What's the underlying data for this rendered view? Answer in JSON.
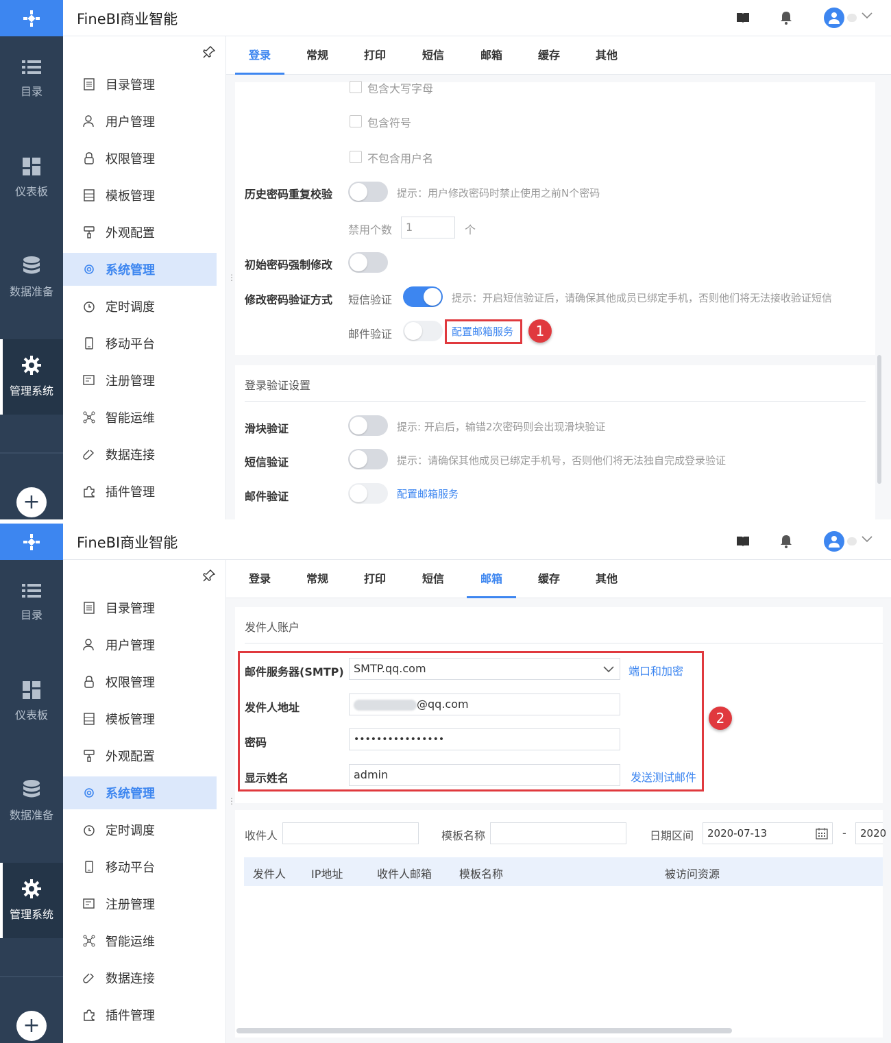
{
  "app": {
    "title": "FineBI商业智能"
  },
  "rail": {
    "items": [
      {
        "label": "目录",
        "icon": "list-icon"
      },
      {
        "label": "仪表板",
        "icon": "dashboard-icon"
      },
      {
        "label": "数据准备",
        "icon": "database-icon"
      },
      {
        "label": "管理系统",
        "icon": "gear-icon"
      }
    ],
    "add": "+"
  },
  "menu": {
    "items": [
      {
        "label": "目录管理",
        "icon": "catalog-icon"
      },
      {
        "label": "用户管理",
        "icon": "user-icon"
      },
      {
        "label": "权限管理",
        "icon": "lock-icon"
      },
      {
        "label": "模板管理",
        "icon": "template-icon"
      },
      {
        "label": "外观配置",
        "icon": "brush-icon"
      },
      {
        "label": "系统管理",
        "icon": "settings-icon"
      },
      {
        "label": "定时调度",
        "icon": "clock-icon"
      },
      {
        "label": "移动平台",
        "icon": "mobile-icon"
      },
      {
        "label": "注册管理",
        "icon": "register-icon"
      },
      {
        "label": "智能运维",
        "icon": "network-icon"
      },
      {
        "label": "数据连接",
        "icon": "link-icon"
      },
      {
        "label": "插件管理",
        "icon": "puzzle-icon"
      }
    ],
    "active_index": 5
  },
  "tabs": [
    "登录",
    "常规",
    "打印",
    "短信",
    "邮箱",
    "缓存",
    "其他"
  ],
  "panel1": {
    "active_tab": 0,
    "checkboxes": [
      "包含大写字母",
      "包含符号",
      "不包含用户名"
    ],
    "history_check": {
      "label": "历史密码重复校验",
      "hint": "提示：用户修改密码时禁止使用之前N个密码",
      "on": false
    },
    "forbid_count": {
      "label": "禁用个数",
      "value": "1",
      "unit": "个"
    },
    "initial_force": {
      "label": "初始密码强制修改",
      "on": false
    },
    "verify_method": {
      "label": "修改密码验证方式",
      "sms_label": "短信验证",
      "sms_on": true,
      "sms_hint": "提示：开启短信验证后，请确保其他成员已绑定手机，否则他们将无法接收验证短信",
      "mail_label": "邮件验证",
      "mail_link": "配置邮箱服务"
    },
    "login_section": {
      "title": "登录验证设置",
      "slider": {
        "label": "滑块验证",
        "hint": "提示: 开启后，输错2次密码则会出现滑块验证"
      },
      "sms": {
        "label": "短信验证",
        "hint": "提示：请确保其他成员已绑定手机号，否则他们将无法独自完成登录验证"
      },
      "mail": {
        "label": "邮件验证",
        "link": "配置邮箱服务"
      }
    },
    "badge": "1"
  },
  "panel2": {
    "active_tab": 4,
    "section_title": "发件人账户",
    "smtp": {
      "label": "邮件服务器(SMTP)",
      "value": "SMTP.qq.com",
      "link": "端口和加密"
    },
    "sender": {
      "label": "发件人地址",
      "value": "@qq.com"
    },
    "password": {
      "label": "密码",
      "value": "••••••••••••••••"
    },
    "display_name": {
      "label": "显示姓名",
      "value": "admin",
      "link": "发送测试邮件"
    },
    "badge": "2",
    "filters": {
      "recipient": "收件人",
      "template": "模板名称",
      "date_range": "日期区间",
      "date_start": "2020-07-13",
      "date_sep": "-",
      "date_end": "2020"
    },
    "columns": [
      "发件人",
      "IP地址",
      "收件人邮箱",
      "模板名称",
      "被访问资源"
    ]
  }
}
